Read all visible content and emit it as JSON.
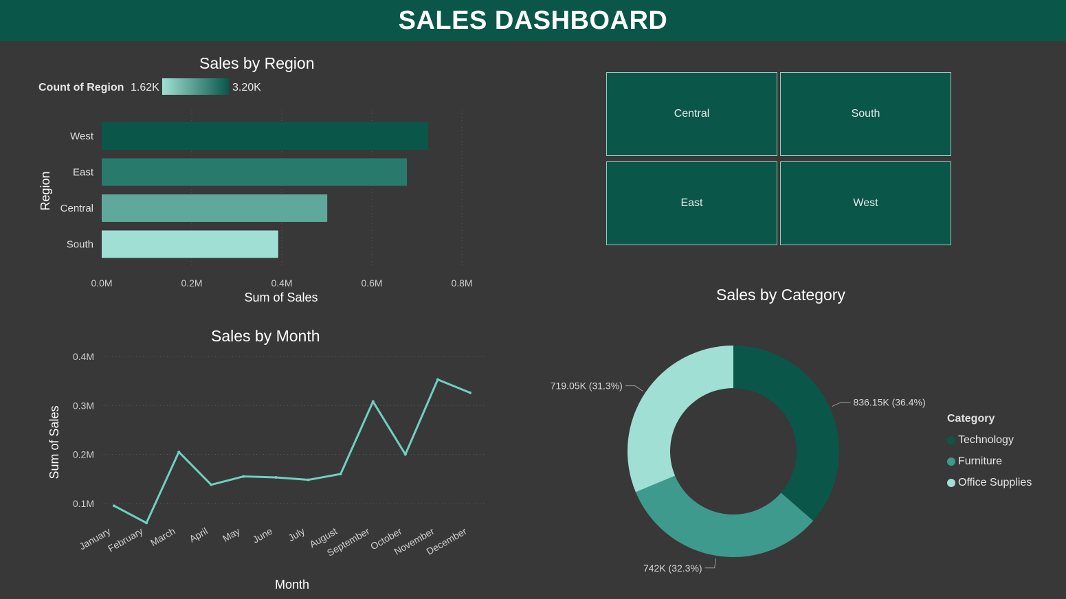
{
  "header": {
    "title": "SALES DASHBOARD"
  },
  "colors": {
    "background": "#383838",
    "header": "#0a5749",
    "dark_green": "#0a5749",
    "mid_green": "#3e9a8c",
    "light_green": "#a0e0d4",
    "line": "#6fd0c0"
  },
  "region_chart": {
    "title": "Sales by Region",
    "legend_label": "Count of Region",
    "legend_min": "1.62K",
    "legend_max": "3.20K"
  },
  "map": {
    "tiles": [
      "Central",
      "South",
      "East",
      "West"
    ]
  },
  "month_chart": {
    "title": "Sales by Month"
  },
  "category_chart": {
    "title": "Sales by Category",
    "legend_title": "Category",
    "items": [
      {
        "name": "Technology",
        "color": "#0a5749"
      },
      {
        "name": "Furniture",
        "color": "#3e9a8c"
      },
      {
        "name": "Office Supplies",
        "color": "#a0e0d4"
      }
    ]
  },
  "chart_data": [
    {
      "type": "bar",
      "title": "Sales by Region",
      "categories": [
        "West",
        "East",
        "Central",
        "South"
      ],
      "values": [
        725000,
        678000,
        501000,
        392000
      ],
      "colors": [
        "#0a5749",
        "#287a6c",
        "#5fa89c",
        "#a0e0d4"
      ],
      "xlabel": "Sum of Sales",
      "ylabel": "Region",
      "xlim": [
        0,
        800000
      ],
      "ticks": [
        0,
        200000,
        400000,
        600000,
        800000
      ],
      "tick_labels": [
        "0.0M",
        "0.2M",
        "0.4M",
        "0.6M",
        "0.8M"
      ],
      "grid": true
    },
    {
      "type": "line",
      "title": "Sales by Month",
      "categories": [
        "January",
        "February",
        "March",
        "April",
        "May",
        "June",
        "July",
        "August",
        "September",
        "October",
        "November",
        "December"
      ],
      "values": [
        95000,
        60000,
        205000,
        138000,
        155000,
        153000,
        148000,
        160000,
        308000,
        200000,
        353000,
        326000
      ],
      "xlabel": "Month",
      "ylabel": "Sum of Sales",
      "ylim": [
        0,
        400000
      ],
      "ticks": [
        100000,
        200000,
        300000,
        400000
      ],
      "tick_labels": [
        "0.1M",
        "0.2M",
        "0.3M",
        "0.4M"
      ],
      "grid": true
    },
    {
      "type": "pie",
      "title": "Sales by Category",
      "categories": [
        "Technology",
        "Furniture",
        "Office Supplies"
      ],
      "values": [
        836150,
        742000,
        719050
      ],
      "percents": [
        36.4,
        32.3,
        31.3
      ],
      "labels": [
        "836.15K (36.4%)",
        "742K (32.3%)",
        "719.05K (31.3%)"
      ],
      "colors": [
        "#0a5749",
        "#3e9a8c",
        "#a0e0d4"
      ],
      "legend": "right",
      "donut": true
    }
  ]
}
